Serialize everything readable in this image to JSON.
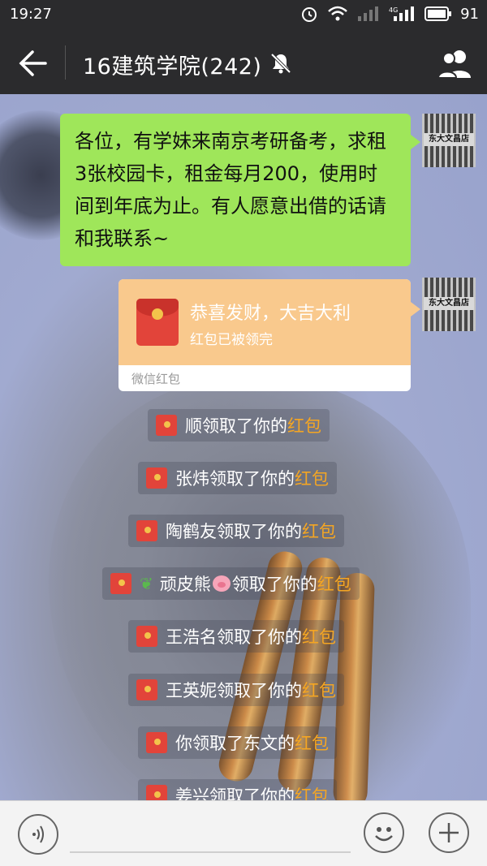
{
  "status_bar": {
    "time": "19:27",
    "battery": "91",
    "network": "4G"
  },
  "header": {
    "title": "16建筑学院(242)"
  },
  "messages": {
    "text_bubble": "各位，有学妹来南京考研备考，求租3张校园卡，租金每月200，使用时间到年底为止。有人愿意出借的话请和我联系~",
    "avatar_sign": "东大文昌店",
    "red_packet": {
      "title": "恭喜发财，大吉大利",
      "subtitle": "红包已被领完",
      "footer": "微信红包"
    }
  },
  "notices": [
    {
      "prefix": "顺领取了你的",
      "suffix": "红包"
    },
    {
      "prefix": "张炜领取了你的",
      "suffix": "红包"
    },
    {
      "prefix": "陶鹤友领取了你的",
      "suffix": "红包"
    },
    {
      "name": "顽皮熊",
      "prefix": "领取了你的",
      "suffix": "红包"
    },
    {
      "prefix": "王浩名领取了你的",
      "suffix": "红包"
    },
    {
      "prefix": "王英妮领取了你的",
      "suffix": "红包"
    },
    {
      "prefix": "你领取了东文的",
      "suffix": "红包"
    },
    {
      "prefix": "姜兴领取了你的",
      "suffix": "红包"
    }
  ],
  "colors": {
    "bar": "#2b2b2d",
    "bubble": "#9fe65a",
    "packet": "#f9c98d",
    "highlight": "#f5a623"
  }
}
